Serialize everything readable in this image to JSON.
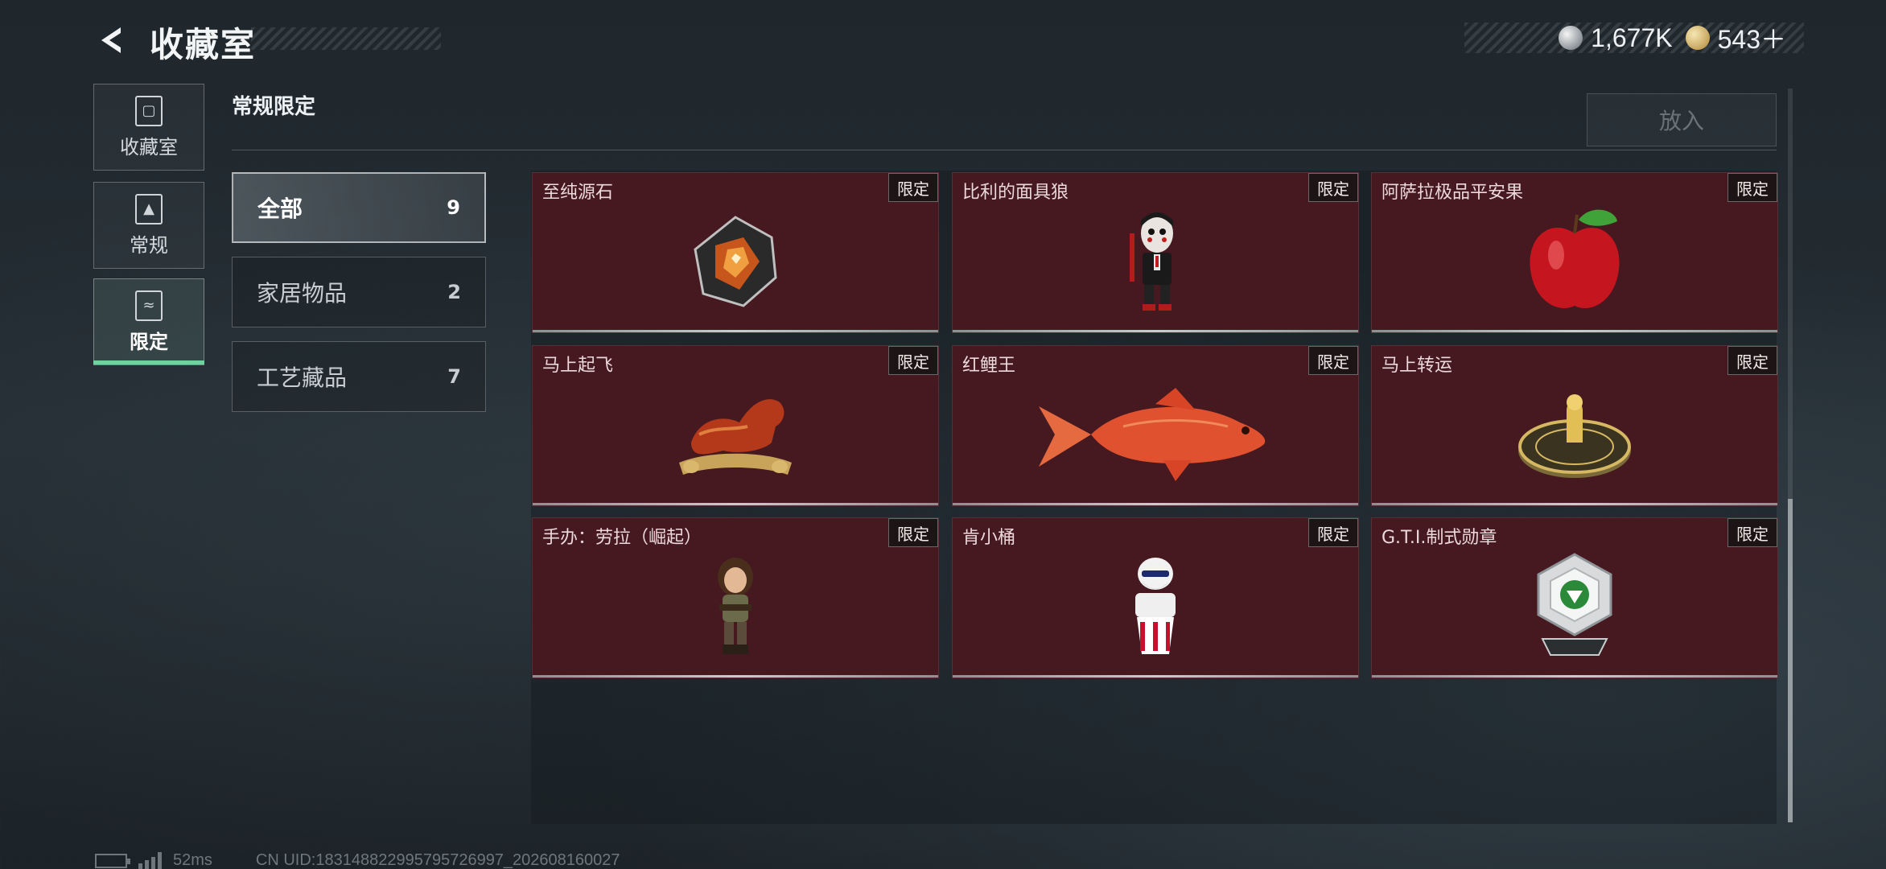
{
  "header": {
    "title": "收藏室",
    "currency": [
      {
        "icon": "silver-coin-icon",
        "value": "1,677K"
      },
      {
        "icon": "gold-coin-icon",
        "value": "543＋"
      }
    ]
  },
  "nav": {
    "items": [
      {
        "label": "收藏室",
        "icon": "cabinet-icon",
        "active": false
      },
      {
        "label": "常规",
        "icon": "card-icon",
        "active": false
      },
      {
        "label": "限定",
        "icon": "image-frame-icon",
        "active": true
      }
    ]
  },
  "section": {
    "title": "常规限定",
    "put_button": "放入"
  },
  "categories": [
    {
      "name": "全部",
      "count": "9",
      "active": true
    },
    {
      "name": "家居物品",
      "count": "2",
      "active": false
    },
    {
      "name": "工艺藏品",
      "count": "7",
      "active": false
    }
  ],
  "items": [
    {
      "name": "至纯源石",
      "badge": "限定",
      "art": "crystal"
    },
    {
      "name": "比利的面具狼",
      "badge": "限定",
      "art": "puppet"
    },
    {
      "name": "阿萨拉极品平安果",
      "badge": "限定",
      "art": "apple"
    },
    {
      "name": "马上起飞",
      "badge": "限定",
      "art": "horse"
    },
    {
      "name": "红鲤王",
      "badge": "限定",
      "art": "fish"
    },
    {
      "name": "马上转运",
      "badge": "限定",
      "art": "compass"
    },
    {
      "name": "手办：劳拉（崛起）",
      "badge": "限定",
      "art": "figure"
    },
    {
      "name": "肯小桶",
      "badge": "限定",
      "art": "bucket"
    },
    {
      "name": "G.T.I.制式勋章",
      "badge": "限定",
      "art": "medal"
    }
  ],
  "footer": {
    "ping": "52ms",
    "uid": "CN UID:183148822995795726997_202608160027"
  },
  "colors": {
    "card_bg": "#45191f",
    "accent": "#6fd3a0"
  }
}
